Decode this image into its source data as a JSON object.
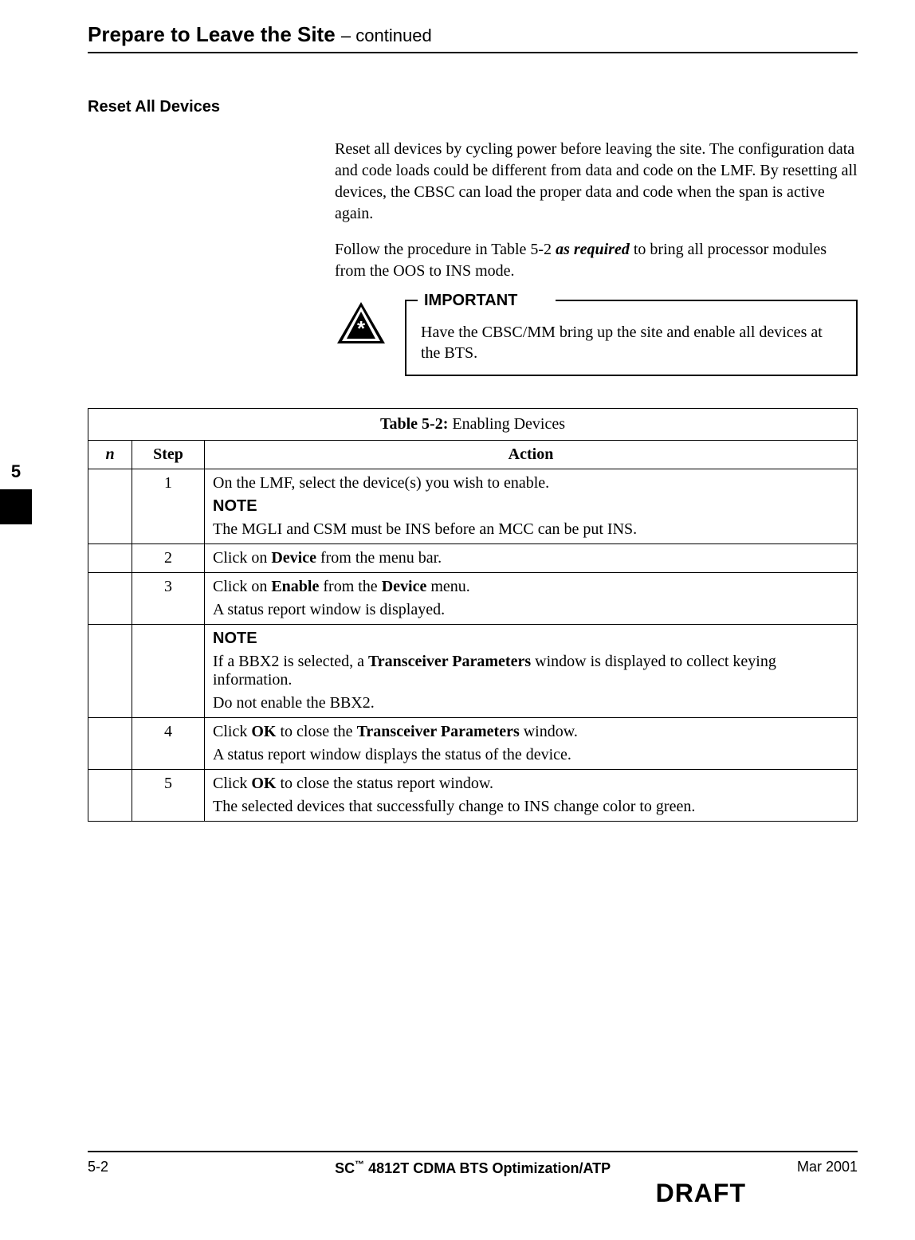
{
  "header": {
    "title": "Prepare to Leave the Site",
    "continued": " – continued"
  },
  "section": {
    "heading": "Reset All Devices",
    "para1": "Reset all devices by cycling power before leaving the site. The configuration data and code loads could be different from data and code on the LMF. By resetting all devices, the CBSC can load the proper data and code when the span is active again.",
    "para2_a": "Follow the procedure in Table 5-2 ",
    "para2_b": "as required",
    "para2_c": " to bring all processor modules from the OOS to INS mode."
  },
  "important": {
    "label": "IMPORTANT",
    "text": "Have the CBSC/MM bring up the site and enable all devices at the BTS."
  },
  "table": {
    "title_bold": "Table 5-2:",
    "title_rest": " Enabling Devices",
    "headers": {
      "check": "n",
      "step": "Step",
      "action": "Action"
    },
    "rows": {
      "r1": {
        "step": "1",
        "line1": "On the LMF, select the device(s) you wish to enable.",
        "note_label": "NOTE",
        "note_text": "The MGLI and CSM must be INS before an MCC can be put INS."
      },
      "r2": {
        "step": "2",
        "pre": "Click on ",
        "bold": "Device",
        "post": " from the menu bar."
      },
      "r3": {
        "step": "3",
        "l1_pre": "Click on ",
        "l1_b1": "Enable",
        "l1_mid": " from the ",
        "l1_b2": "Device",
        "l1_post": " menu.",
        "l2": "A status report window is displayed."
      },
      "r4": {
        "note_label": "NOTE",
        "l1_pre": "If a BBX2 is selected, a ",
        "l1_b": "Transceiver Parameters",
        "l1_post": " window is displayed to collect keying information.",
        "l2": "Do not enable the BBX2."
      },
      "r5": {
        "step": "4",
        "l1_pre": "Click ",
        "l1_b1": "OK",
        "l1_mid": " to close the ",
        "l1_b2": "Transceiver Parameters",
        "l1_post": " window.",
        "l2": "A status report window displays the status of the device."
      },
      "r6": {
        "step": "5",
        "l1_pre": "Click ",
        "l1_b": "OK",
        "l1_post": " to close the status report window.",
        "l2": "The selected devices that successfully change to INS change color to green."
      }
    }
  },
  "sidetab": {
    "chapter": "5"
  },
  "footer": {
    "page": "5-2",
    "doc_prefix": "SC",
    "doc_rest": "4812T CDMA BTS Optimization/ATP",
    "date": "Mar 2001",
    "draft": "DRAFT"
  }
}
